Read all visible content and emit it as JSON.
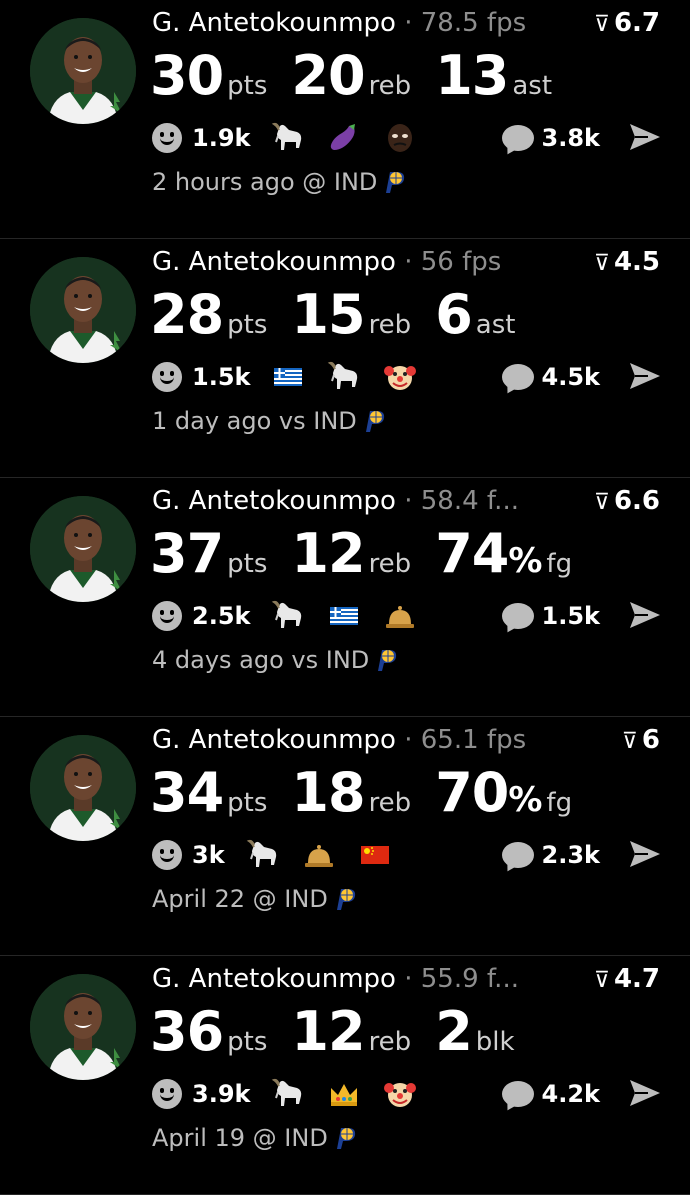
{
  "feed": [
    {
      "name": "G. Antetokounmpo",
      "fps": "· 78.5 fps",
      "rating": "6.7",
      "stats": [
        {
          "num": "30",
          "unit": "pts"
        },
        {
          "num": "20",
          "unit": "reb"
        },
        {
          "num": "13",
          "unit": "ast"
        }
      ],
      "reactions": "1.9k",
      "emojis": [
        "goat-emoji",
        "eggplant-emoji",
        "face-emoji"
      ],
      "comments": "3.8k",
      "time": "2 hours ago @ IND"
    },
    {
      "name": "G. Antetokounmpo",
      "fps": "· 56 fps",
      "rating": "4.5",
      "stats": [
        {
          "num": "28",
          "unit": "pts"
        },
        {
          "num": "15",
          "unit": "reb"
        },
        {
          "num": "6",
          "unit": "ast"
        }
      ],
      "reactions": "1.5k",
      "emojis": [
        "greece-flag-emoji",
        "goat-emoji",
        "clown-emoji"
      ],
      "comments": "4.5k",
      "time": "1 day ago vs IND"
    },
    {
      "name": "G. Antetokounmpo",
      "fps": "· 58.4 f...",
      "rating": "6.6",
      "stats": [
        {
          "num": "37",
          "unit": "pts"
        },
        {
          "num": "12",
          "unit": "reb"
        },
        {
          "num": "74",
          "pct": "%",
          "unit": "fg"
        }
      ],
      "reactions": "2.5k",
      "emojis": [
        "goat-emoji",
        "greece-flag-emoji",
        "bell-emoji"
      ],
      "comments": "1.5k",
      "time": "4 days ago vs IND"
    },
    {
      "name": "G. Antetokounmpo",
      "fps": "· 65.1 fps",
      "rating": "6",
      "stats": [
        {
          "num": "34",
          "unit": "pts"
        },
        {
          "num": "18",
          "unit": "reb"
        },
        {
          "num": "70",
          "pct": "%",
          "unit": "fg"
        }
      ],
      "reactions": "3k",
      "emojis": [
        "goat-emoji",
        "bell-emoji",
        "china-flag-emoji"
      ],
      "comments": "2.3k",
      "time": "April 22 @ IND"
    },
    {
      "name": "G. Antetokounmpo",
      "fps": "· 55.9 f...",
      "rating": "4.7",
      "stats": [
        {
          "num": "36",
          "unit": "pts"
        },
        {
          "num": "12",
          "unit": "reb"
        },
        {
          "num": "2",
          "unit": "blk"
        }
      ],
      "reactions": "3.9k",
      "emojis": [
        "goat-emoji",
        "crown-emoji",
        "clown-emoji"
      ],
      "comments": "4.2k",
      "time": "April 19 @ IND"
    }
  ],
  "colors": {
    "background": "#000000",
    "muted": "#8e8e8e",
    "icon": "#bdbdbd",
    "pacers_gold": "#ffc633",
    "pacers_blue": "#1c3f94",
    "bucks_green": "#17331f"
  }
}
